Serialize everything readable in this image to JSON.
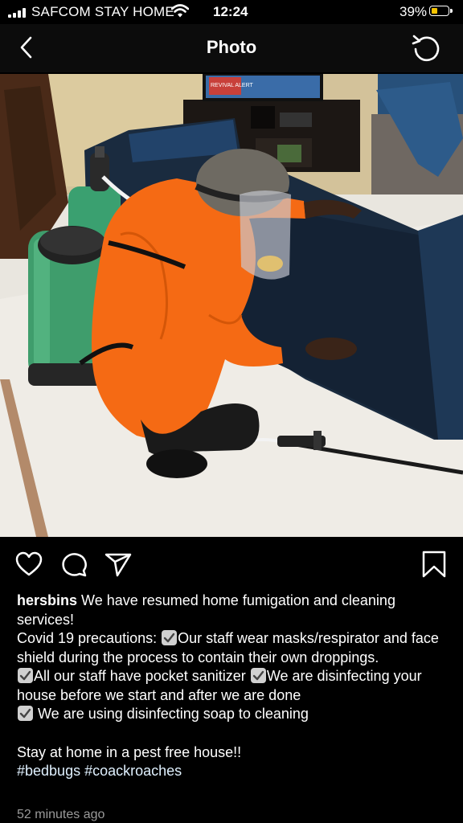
{
  "status_bar": {
    "carrier": "SAFCOM STAY HOME",
    "time": "12:24",
    "battery": "39%",
    "battery_level": 0.39,
    "battery_color": "#f5c400"
  },
  "nav": {
    "back_icon": "chevron-left-icon",
    "title": "Photo",
    "refresh_icon": "refresh-icon"
  },
  "photo": {
    "tv_text": "REVIVAL ALERT"
  },
  "actions": {
    "like_icon": "heart-icon",
    "comment_icon": "comment-icon",
    "share_icon": "send-icon",
    "save_icon": "bookmark-icon"
  },
  "post": {
    "username": "hersbins",
    "line1": "We have resumed home fumigation and cleaning services!",
    "line2a": "Covid 19 precautions:",
    "line2b": "Our staff wear masks/respirator and face shield during the process to contain their own droppings.",
    "line3a": "All our staff have pocket sanitizer",
    "line3b": "We are disinfecting your house before we start and after we are done",
    "line4": "We are using disinfecting soap to cleaning",
    "line5": "Stay at home in a pest free house!!",
    "hashtag1": "#bedbugs",
    "hashtag2": "#coackroaches",
    "time_ago": "52 minutes ago"
  }
}
